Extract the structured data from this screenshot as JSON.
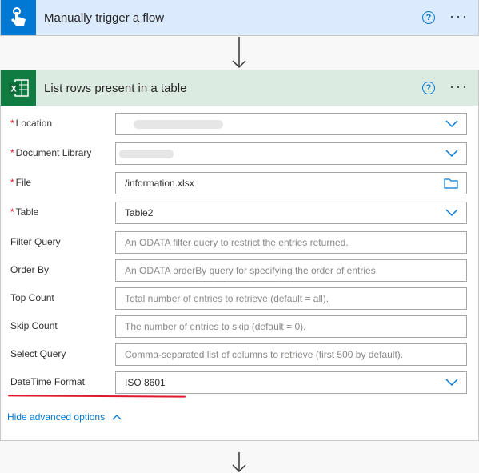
{
  "trigger": {
    "title": "Manually trigger a flow",
    "help": "?",
    "more": "···",
    "color": "#0078d4"
  },
  "action": {
    "title": "List rows present in a table",
    "help": "?",
    "more": "···",
    "color": "#107c41"
  },
  "fields": [
    {
      "label": "Location",
      "required": true,
      "value": "",
      "type": "dropdown"
    },
    {
      "label": "Document Library",
      "required": true,
      "value": "",
      "type": "dropdown"
    },
    {
      "label": "File",
      "required": true,
      "value": "/information.xlsx",
      "type": "file"
    },
    {
      "label": "Table",
      "required": true,
      "value": "Table2",
      "type": "dropdown"
    },
    {
      "label": "Filter Query",
      "placeholder": "An ODATA filter query to restrict the entries returned."
    },
    {
      "label": "Order By",
      "placeholder": "An ODATA orderBy query for specifying the order of entries."
    },
    {
      "label": "Top Count",
      "placeholder": "Total number of entries to retrieve (default = all)."
    },
    {
      "label": "Skip Count",
      "placeholder": "The number of entries to skip (default = 0)."
    },
    {
      "label": "Select Query",
      "placeholder": "Comma-separated list of columns to retrieve (first 500 by default)."
    },
    {
      "label": "DateTime Format",
      "value": "ISO 8601",
      "type": "dropdown"
    }
  ],
  "required_mark": "*",
  "hide_advanced": "Hide advanced options"
}
